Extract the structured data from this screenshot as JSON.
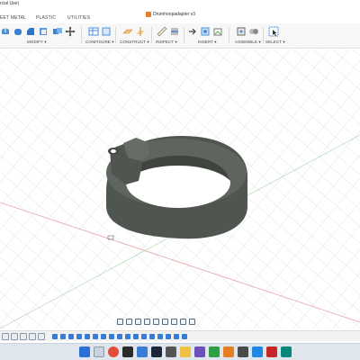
{
  "window": {
    "license_label": "rcial Use)",
    "document_title": "Drumhoopadapter v3"
  },
  "tabs": [
    {
      "label": "EET METAL"
    },
    {
      "label": "PLASTIC"
    },
    {
      "label": "UTILITIES"
    }
  ],
  "ribbon": {
    "groups": [
      {
        "label": "MODIFY ▾"
      },
      {
        "label": "CONFIGURE ▾"
      },
      {
        "label": "CONSTRUCT ▾"
      },
      {
        "label": "INSPECT ▾"
      },
      {
        "label": "INSERT ▾"
      },
      {
        "label": "ASSEMBLE ▾"
      },
      {
        "label": "SELECT ▾"
      }
    ]
  },
  "viewport": {
    "colors": {
      "background": "#ffffff",
      "grid": "#e7e9ed",
      "axis_red": "#e6a3a3",
      "axis_green": "#a9d3a9",
      "model": "#555b55",
      "model_dark": "#3a3f3a"
    }
  },
  "colors": {
    "accent": "#3a7bd5",
    "taskbar": "#dfe6ee"
  }
}
